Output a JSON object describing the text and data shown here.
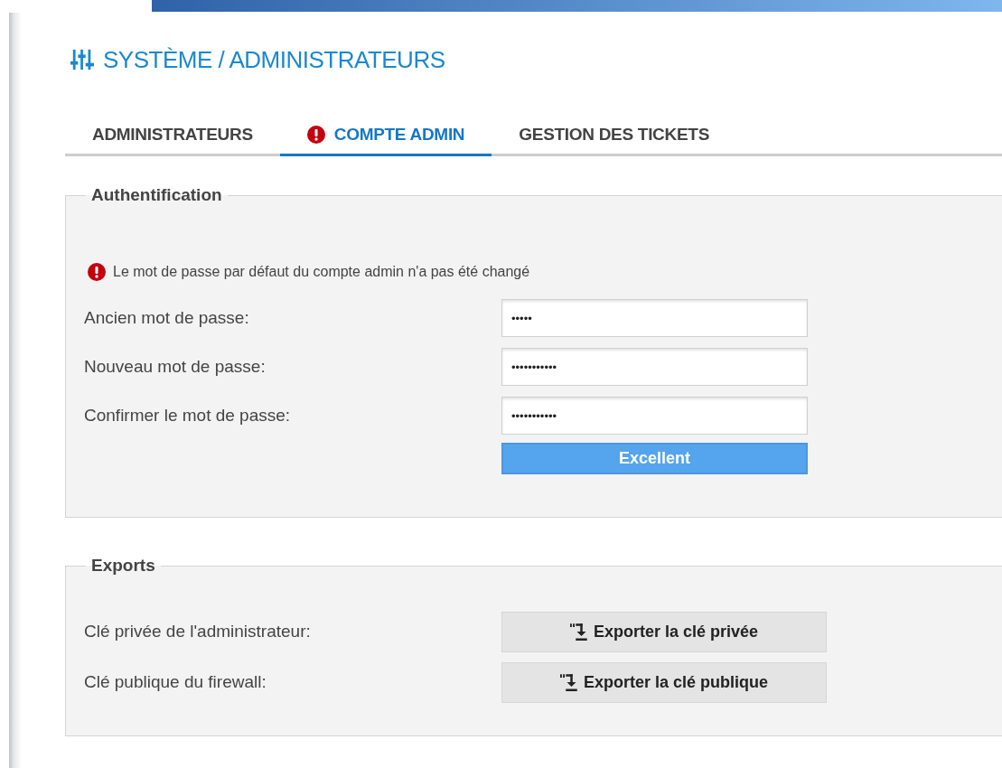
{
  "header": {
    "title": "SYSTÈME / ADMINISTRATEURS"
  },
  "tabs": [
    {
      "label": "ADMINISTRATEURS",
      "selected": false,
      "warning": false
    },
    {
      "label": "COMPTE ADMIN",
      "selected": true,
      "warning": true
    },
    {
      "label": "GESTION DES TICKETS",
      "selected": false,
      "warning": false
    }
  ],
  "authentication": {
    "legend": "Authentification",
    "alert": "Le mot de passe par défaut du compte admin n'a pas été changé",
    "fields": [
      {
        "label": "Ancien mot de passe:",
        "value": "•••••"
      },
      {
        "label": "Nouveau mot de passe:",
        "value": "•••••••••••"
      },
      {
        "label": "Confirmer le mot de passe:",
        "value": "•••••••••••"
      }
    ],
    "strength": {
      "label": "Excellent",
      "level": 1
    }
  },
  "exports": {
    "legend": "Exports",
    "rows": [
      {
        "label": "Clé privée de l'administrateur:",
        "button": "Exporter la clé privée"
      },
      {
        "label": "Clé publique du firewall:",
        "button": "Exporter la clé publique"
      }
    ]
  }
}
